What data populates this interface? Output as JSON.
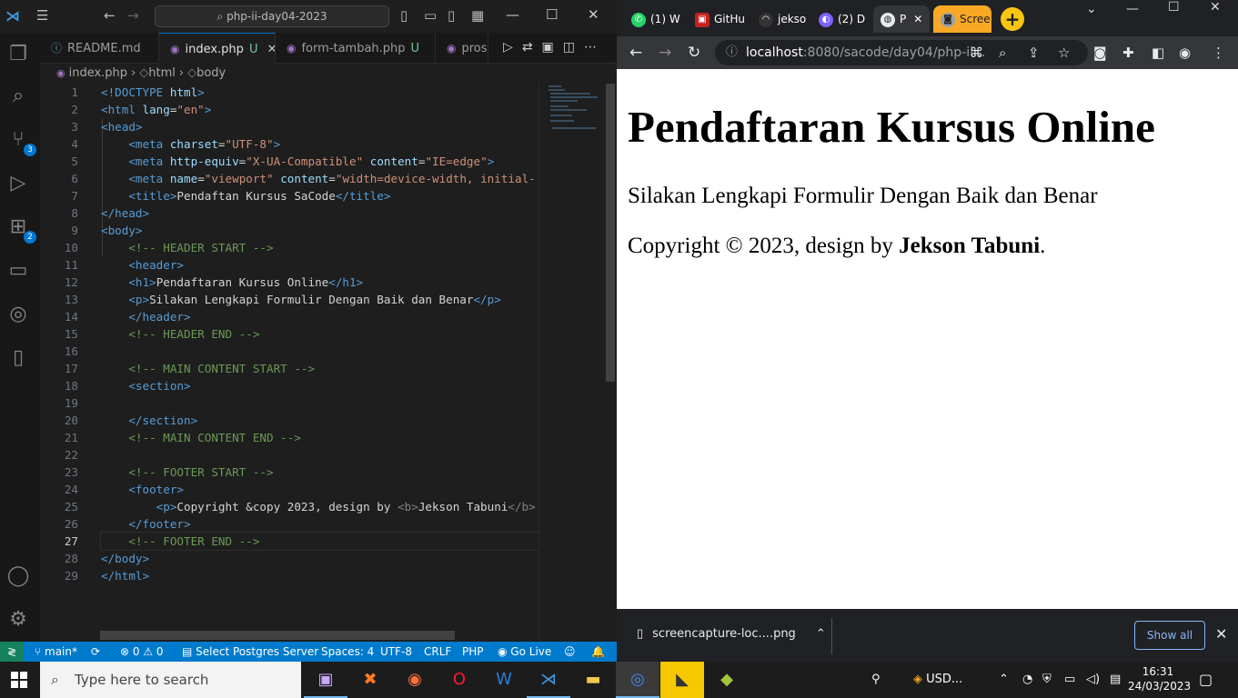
{
  "vscode": {
    "search_text": "php-ii-day04-2023",
    "tabs": [
      {
        "label": "README.md",
        "status": ""
      },
      {
        "label": "index.php",
        "status": "U"
      },
      {
        "label": "form-tambah.php",
        "status": "U"
      },
      {
        "label": "pros",
        "status": ""
      }
    ],
    "breadcrumb": [
      "index.php",
      "html",
      "body"
    ],
    "badges": {
      "source_control": "3",
      "extensions": "2"
    },
    "line_numbers": [
      "1",
      "2",
      "3",
      "4",
      "5",
      "6",
      "7",
      "8",
      "9",
      "10",
      "11",
      "12",
      "13",
      "14",
      "15",
      "16",
      "17",
      "18",
      "19",
      "20",
      "21",
      "22",
      "23",
      "24",
      "25",
      "26",
      "27",
      "28",
      "29"
    ],
    "code": {
      "l1": {
        "a": "<!DOCTYPE ",
        "b": "html",
        "c": ">"
      },
      "l2": {
        "a": "<html ",
        "b": "lang",
        "c": "=",
        "d": "\"en\"",
        "e": ">"
      },
      "l3": "<head>",
      "l4": {
        "a": "<meta ",
        "b": "charset",
        "c": "=",
        "d": "\"UTF-8\"",
        "e": ">"
      },
      "l5": {
        "a": "<meta ",
        "b": "http-equiv",
        "c": "=",
        "d": "\"X-UA-Compatible\"",
        "e": " content",
        "f": "=",
        "g": "\"IE=edge\"",
        "h": ">"
      },
      "l6": {
        "a": "<meta ",
        "b": "name",
        "c": "=",
        "d": "\"viewport\"",
        "e": " content",
        "f": "=",
        "g": "\"width=device-width, initial-"
      },
      "l7": {
        "a": "<title>",
        "b": "Pendaftan Kursus SaCode",
        "c": "</title>"
      },
      "l8": "</head>",
      "l9": "<body>",
      "l10": "<!-- HEADER START -->",
      "l11": "<header>",
      "l12": {
        "a": "<h1>",
        "b": "Pendaftaran Kursus Online",
        "c": "</h1>"
      },
      "l13": {
        "a": "<p>",
        "b": "Silakan Lengkapi Formulir Dengan Baik dan Benar",
        "c": "</p>"
      },
      "l14": "</header>",
      "l15": "<!-- HEADER END -->",
      "l17": "<!-- MAIN CONTENT START -->",
      "l18": "<section>",
      "l20": "</section>",
      "l21": "<!-- MAIN CONTENT END -->",
      "l23": "<!-- FOOTER START -->",
      "l24": "<footer>",
      "l25": {
        "a": "<p>",
        "b": "Copyright &copy 2023, design by ",
        "c": "<b>",
        "d": "Jekson Tabuni",
        "e": "</b>"
      },
      "l26": "</footer>",
      "l27": "<!-- FOOTER END -->",
      "l28": "</body>",
      "l29": "</html>"
    },
    "status": {
      "branch": "main*",
      "errors": "0",
      "warnings": "0",
      "postgres": "Select Postgres Server",
      "spaces": "Spaces: 4",
      "encoding": "UTF-8",
      "eol": "CRLF",
      "language": "PHP",
      "golive": "Go Live"
    }
  },
  "chrome": {
    "tabs": [
      {
        "label": "(1) W",
        "color": "#25d366"
      },
      {
        "label": "GitHu",
        "color": "#c5221f"
      },
      {
        "label": "jekso",
        "color": "#333333"
      },
      {
        "label": "(2) D",
        "color": "#7b61ff"
      },
      {
        "label": "P",
        "color": "#e8eaed"
      },
      {
        "label": "Scree",
        "color": "#9aa0a6"
      }
    ],
    "url_host": "localhost",
    "url_path": ":8080/sacode/day04/php-ii...",
    "page": {
      "h1": "Pendaftaran Kursus Online",
      "p": "Silakan Lengkapi Formulir Dengan Baik dan Benar",
      "footer_prefix": "Copyright © 2023, design by ",
      "footer_name": "Jekson Tabuni",
      "footer_suffix": "."
    },
    "download": {
      "filename": "screencapture-loc....png",
      "show_all": "Show all"
    }
  },
  "taskbar": {
    "search_placeholder": "Type here to search",
    "currency": "USD...",
    "time": "16:31",
    "date": "24/03/2023"
  }
}
